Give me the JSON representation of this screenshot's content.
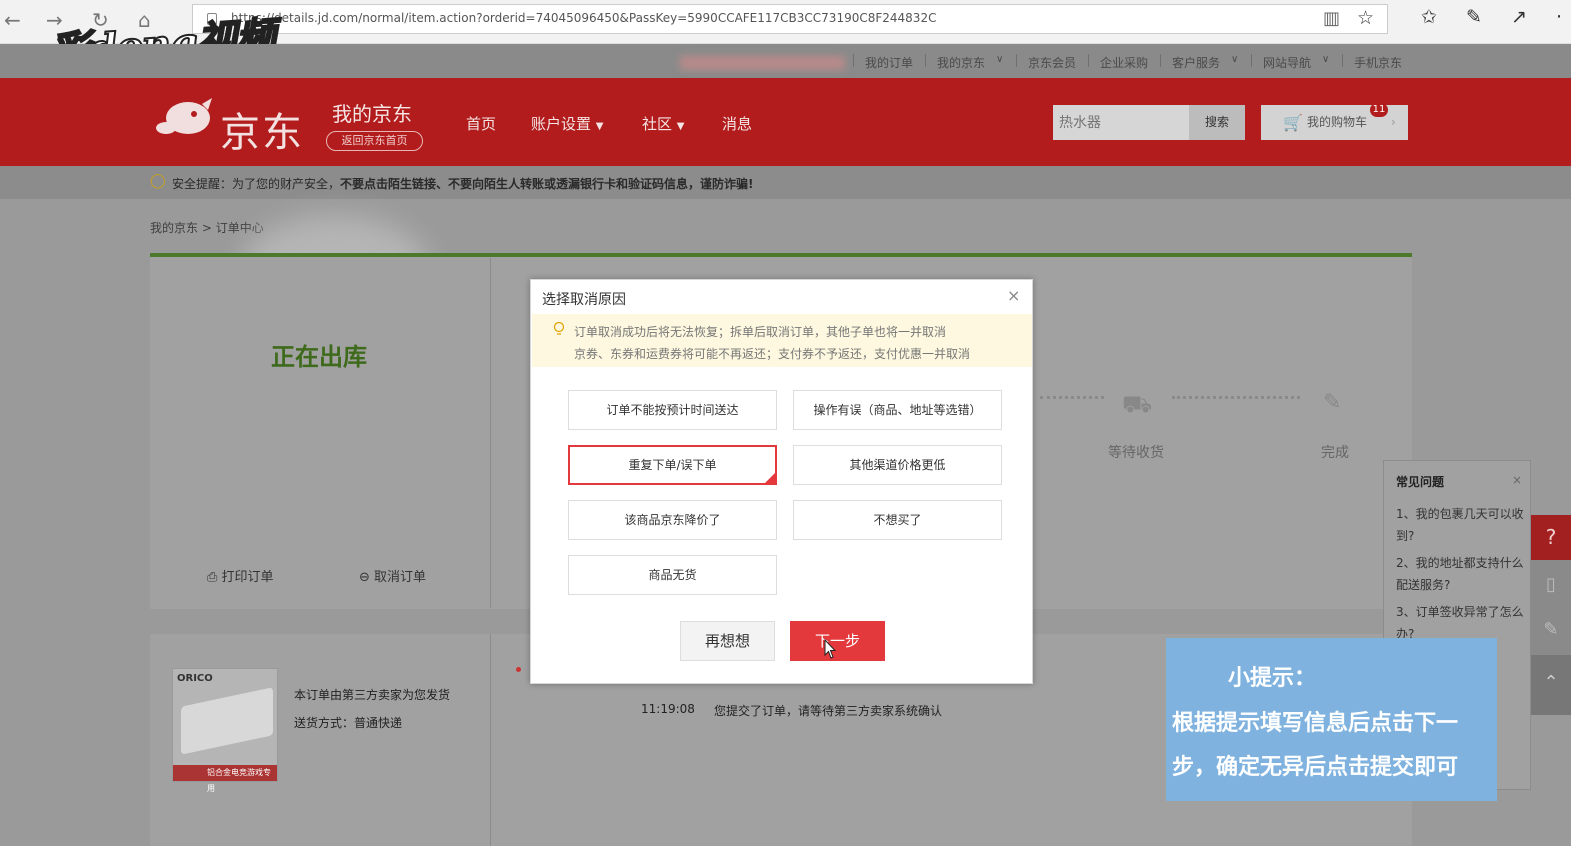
{
  "browser": {
    "url": "https://details.jd.com/normal/item.action?orderid=74045096450&PassKey=5990CCAFE117CB3CC73190C8F244832C",
    "icons": [
      "back-icon",
      "forward-icon",
      "refresh-icon",
      "home-icon",
      "reader-icon",
      "star-icon",
      "favorites-icon",
      "pen-icon",
      "share-icon",
      "more-icon"
    ]
  },
  "watermark": {
    "text": "彩dong视频"
  },
  "top_links": [
    "我的订单",
    "我的京东",
    "京东会员",
    "企业采购",
    "客户服务",
    "网站导航",
    "手机京东"
  ],
  "header": {
    "logo": "京东",
    "my_jd": "我的京东",
    "back_home": "返回京东首页",
    "nav": [
      "首页",
      "账户设置",
      "社区",
      "消息"
    ],
    "search_placeholder": "热水器",
    "search_button": "搜索",
    "cart_label": "我的购物车",
    "cart_count": "11",
    "brand_color": "#b31c1c"
  },
  "security": {
    "label": "安全提醒：为了您的财产安全，",
    "bold": "不要点击陌生链接、不要向陌生人转账或透漏银行卡和验证码信息，谨防诈骗!"
  },
  "breadcrumb": [
    "我的京东",
    "订单中心"
  ],
  "order": {
    "status": "正在出库",
    "print": "打印订单",
    "cancel": "取消订单",
    "steps": [
      "等待收货",
      "完成"
    ],
    "seller_note": "本订单由第三方卖家为您发货",
    "shipping": "送货方式：普通快递",
    "log_time": "11:19:08",
    "log_text": "您提交了订单，请等待第三方卖家系统确认",
    "product_brand": "ORICO",
    "product_tag": "铝合金电竞游戏专用"
  },
  "faq": {
    "title": "常见问题",
    "items": [
      "1、我的包裹几天可以收到?",
      "2、我的地址都支持什么配送服务?",
      "3、订单签收异常了怎么办?"
    ]
  },
  "hint": {
    "title": "小提示：",
    "body": "根据提示填写信息后点击下一步，确定无异后点击提交即可"
  },
  "modal": {
    "title": "选择取消原因",
    "warning_line1": "订单取消成功后将无法恢复；拆单后取消订单，其他子单也将一并取消",
    "warning_line2": "京券、东券和运费券将可能不再返还；支付券不予返还，支付优惠一并取消",
    "reasons": [
      "订单不能按预计时间送达",
      "操作有误（商品、地址等选错）",
      "重复下单/误下单",
      "其他渠道价格更低",
      "该商品京东降价了",
      "不想买了",
      "商品无货"
    ],
    "selected_index": 2,
    "cancel_button": "再想想",
    "next_button": "下一步",
    "accent_color": "#e4393c"
  }
}
